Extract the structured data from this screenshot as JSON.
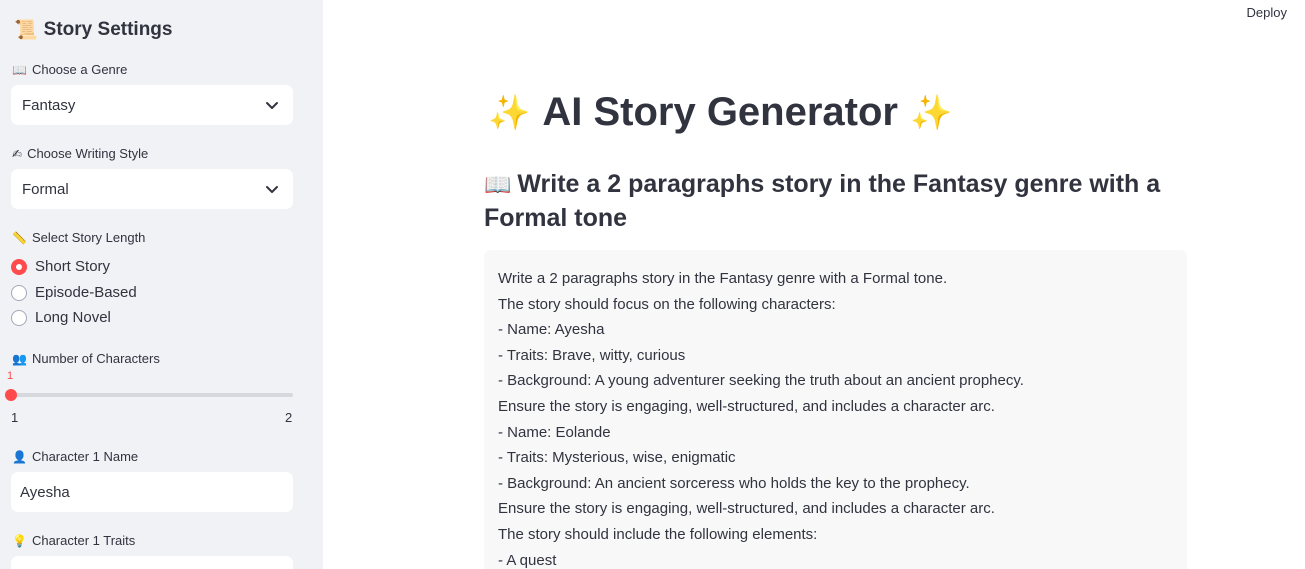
{
  "sidebar": {
    "title": "Story Settings",
    "title_icon": "scroll-icon",
    "genre": {
      "label": "Choose a Genre",
      "icon": "open-book-icon",
      "value": "Fantasy"
    },
    "style": {
      "label": "Choose Writing Style",
      "icon": "writing-hand-icon",
      "value": "Formal"
    },
    "length": {
      "label": "Select Story Length",
      "icon": "ruler-icon",
      "options": [
        "Short Story",
        "Episode-Based",
        "Long Novel"
      ],
      "selected": "Short Story"
    },
    "characters": {
      "label": "Number of Characters",
      "icon": "people-icon",
      "value": "1",
      "min": "1",
      "max": "2"
    },
    "char1_name": {
      "label": "Character 1 Name",
      "icon": "person-icon",
      "value": "Ayesha"
    },
    "char1_traits": {
      "label": "Character 1 Traits",
      "icon": "lightbulb-icon",
      "value": ""
    }
  },
  "header": {
    "deploy_label": "Deploy"
  },
  "main": {
    "title": "AI Story Generator",
    "title_icon": "sparkles-icon",
    "subheading": "Write a 2 paragraphs story in the Fantasy genre with a Formal tone",
    "subheading_icon": "open-book-icon",
    "prompt_lines": [
      "Write a 2 paragraphs story in the Fantasy genre with a Formal tone.",
      "The story should focus on the following characters:",
      "- Name: Ayesha",
      "- Traits: Brave, witty, curious",
      "- Background: A young adventurer seeking the truth about an ancient prophecy.",
      "Ensure the story is engaging, well-structured, and includes a character arc.",
      "- Name: Eolande",
      "- Traits: Mysterious, wise, enigmatic",
      "- Background: An ancient sorceress who holds the key to the prophecy.",
      "Ensure the story is engaging, well-structured, and includes a character arc.",
      "The story should include the following elements:",
      "- A quest"
    ]
  },
  "colors": {
    "accent": "#ff4b4b",
    "sidebar_bg": "#f0f2f6",
    "text": "#31333f"
  }
}
